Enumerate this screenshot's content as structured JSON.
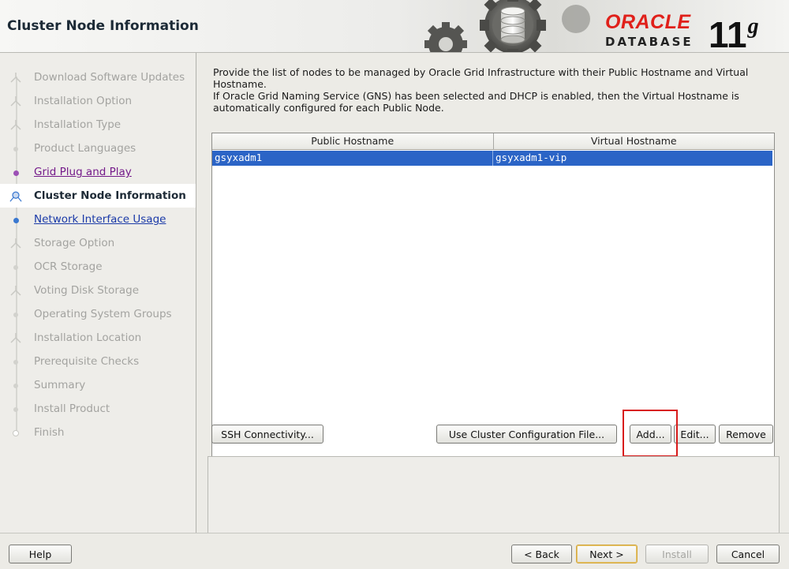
{
  "header": {
    "page_title": "Cluster Node Information",
    "logo_brand": "ORACLE",
    "logo_product": "DATABASE",
    "logo_version_number": "11",
    "logo_version_letter": "g"
  },
  "sidebar": {
    "steps": [
      {
        "label": "Download Software Updates",
        "state": "disabled"
      },
      {
        "label": "Installation Option",
        "state": "disabled"
      },
      {
        "label": "Installation Type",
        "state": "disabled"
      },
      {
        "label": "Product Languages",
        "state": "disabled"
      },
      {
        "label": "Grid Plug and Play",
        "state": "visited"
      },
      {
        "label": "Cluster Node Information",
        "state": "current"
      },
      {
        "label": "Network Interface Usage",
        "state": "link"
      },
      {
        "label": "Storage Option",
        "state": "disabled"
      },
      {
        "label": "OCR Storage",
        "state": "disabled"
      },
      {
        "label": "Voting Disk Storage",
        "state": "disabled"
      },
      {
        "label": "Operating System Groups",
        "state": "disabled"
      },
      {
        "label": "Installation Location",
        "state": "disabled"
      },
      {
        "label": "Prerequisite Checks",
        "state": "disabled"
      },
      {
        "label": "Summary",
        "state": "disabled"
      },
      {
        "label": "Install Product",
        "state": "disabled"
      },
      {
        "label": "Finish",
        "state": "disabled"
      }
    ]
  },
  "main": {
    "instructions_1": "Provide the list of nodes to be managed by Oracle Grid Infrastructure with their Public Hostname and Virtual Hostname.",
    "instructions_2": "If Oracle Grid Naming Service (GNS) has been selected and DHCP is enabled, then the Virtual Hostname is automatically configured for each Public Node.",
    "table": {
      "columns": [
        "Public Hostname",
        "Virtual Hostname"
      ],
      "rows": [
        {
          "public": "gsyxadm1",
          "virtual": "gsyxadm1-vip",
          "selected": true
        }
      ]
    },
    "buttons": {
      "ssh_connectivity": "SSH Connectivity...",
      "use_cluster_config_file": "Use Cluster Configuration File...",
      "add": "Add...",
      "edit": "Edit...",
      "remove": "Remove"
    }
  },
  "footer": {
    "help": "Help",
    "back": "< Back",
    "next": "Next >",
    "install": "Install",
    "cancel": "Cancel"
  },
  "colors": {
    "accent_selection": "#2b64c6",
    "oracle_red": "#e0201a",
    "annotation_box": "#d81b1b",
    "visited_link": "#741a8a",
    "link": "#1b3aa8"
  }
}
